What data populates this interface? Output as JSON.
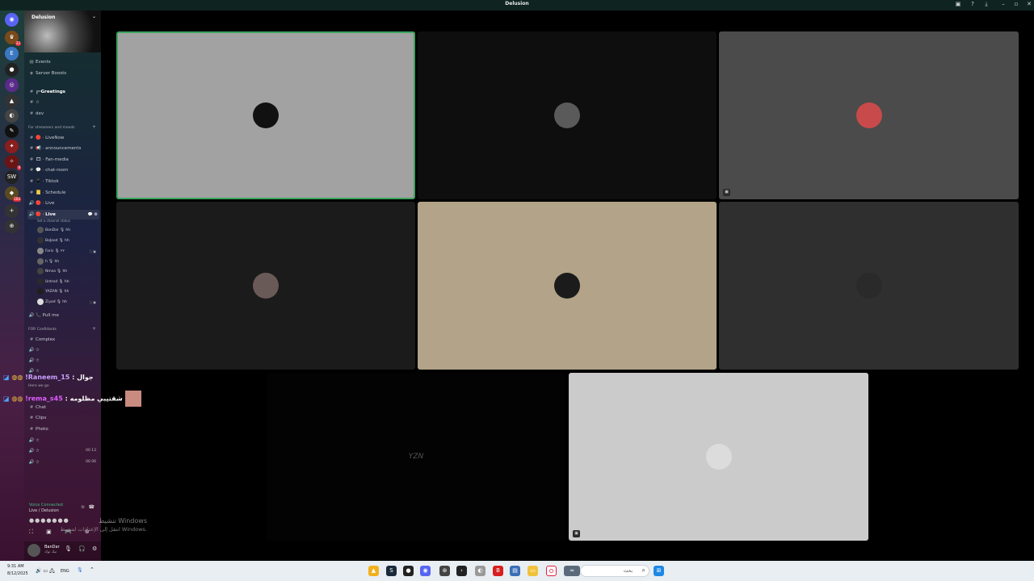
{
  "window": {
    "title": "Delusion"
  },
  "server": {
    "name": "Delusion"
  },
  "nav_items": [
    {
      "label": "Events",
      "icon": "calendar-icon"
    },
    {
      "label": "Server Boosts",
      "icon": "boost-icon"
    }
  ],
  "channels_top": [
    {
      "label": "Greetings",
      "prefix": "╔═"
    },
    {
      "label": "☆"
    },
    {
      "label": "dev"
    }
  ],
  "category_streamers": "For streamers and moods",
  "channels_stream": [
    {
      "label": "LiveNow",
      "emoji": "🔴"
    },
    {
      "label": "announcements",
      "emoji": "📢"
    },
    {
      "label": "Fan-media",
      "emoji": "🎞"
    },
    {
      "label": "chat-room",
      "emoji": "💬"
    },
    {
      "label": "Tiktok",
      "emoji": "📱"
    },
    {
      "label": "Schedule",
      "emoji": "📒"
    },
    {
      "label": "Live",
      "emoji": "🔴",
      "voice": true
    }
  ],
  "active_voice": {
    "label": "Live",
    "status": "Set a channel status"
  },
  "voice_users": [
    {
      "name": "BanDar",
      "tag": "🎙 hh"
    },
    {
      "name": "BoJood",
      "tag": "🎙 hh"
    },
    {
      "name": "Faris",
      "tag": "🎙 ٢٢"
    },
    {
      "name": "h",
      "tag": "🎙 hh"
    },
    {
      "name": "Nmsa",
      "tag": "🎙 hh"
    },
    {
      "name": "Untrod",
      "tag": "🎙 hh"
    },
    {
      "name": "YAZAN",
      "tag": "🎙 hh"
    },
    {
      "name": "Ziyad",
      "tag": "🎙 hh"
    }
  ],
  "pull_me": "Pull me",
  "category_confidants": "FOR Confidants",
  "channels_confidants": [
    {
      "label": "Complex"
    },
    {
      "label": "☆"
    },
    {
      "label": "☆"
    },
    {
      "label": "☆"
    }
  ],
  "overlay_msgs": [
    {
      "user": "!Raneem_15",
      "text": ": جوال"
    },
    {
      "user": "!rema_s45",
      "text": ": شقتيبي مظلومه"
    }
  ],
  "here_we_go": "Here we go",
  "channels_bottom": [
    {
      "label": "Chat"
    },
    {
      "label": "Clips"
    },
    {
      "label": "Photo"
    },
    {
      "label": "☆",
      "voice": true
    },
    {
      "label": "☆",
      "voice": true,
      "count": "00  13"
    },
    {
      "label": "☆",
      "voice": true,
      "count": "00  06"
    }
  ],
  "voice_connected": {
    "title": "Voice Connected",
    "channel": "Live / Delusion"
  },
  "user": {
    "name": "BanDar",
    "status": "تيك توك"
  },
  "activation": {
    "line1": "تنشيط Windows",
    "line2": "انتقل إلى الإعدادات لتنشيط Windows."
  },
  "taskbar": {
    "time": "9:31 AM",
    "date": "8/12/2025",
    "lang": "ENG",
    "search_placeholder": "بحث"
  },
  "tiles": [
    {
      "bg": "#a2a2a2",
      "avatar": "#111"
    },
    {
      "bg": "#0e0e0f",
      "avatar": "#5a5a5a"
    },
    {
      "bg": "#4b4b4b",
      "avatar": "#c84a4a",
      "has_icon": true
    },
    {
      "bg": "#1c1b1b",
      "avatar": "#6a5a57"
    },
    {
      "bg": "#b2a389",
      "avatar": "#1b1b1b"
    },
    {
      "bg": "#2f2f2f",
      "avatar": "#2a2a2a"
    },
    {
      "bg": "#030303",
      "avatar": "#3a3a3a",
      "logo": "YZN"
    },
    {
      "bg": "#cbcbcb",
      "avatar": "#dcdcdc",
      "has_icon": true
    }
  ]
}
